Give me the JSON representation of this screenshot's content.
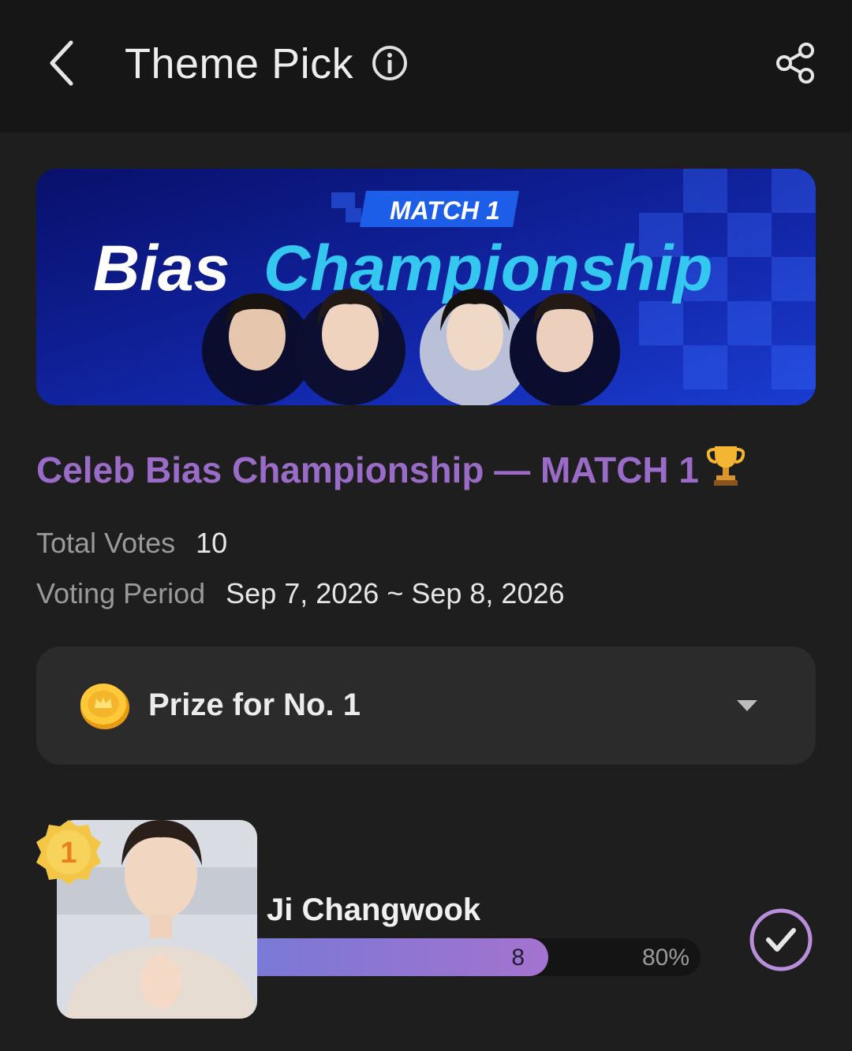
{
  "header": {
    "title": "Theme Pick",
    "icons": {
      "back": "chevron-left-icon",
      "info": "info-icon",
      "share": "share-icon"
    }
  },
  "banner": {
    "match_label": "MATCH 1",
    "title_part1": "Bias",
    "title_part2": "Championship"
  },
  "theme": {
    "title": "Celeb Bias Championship — MATCH 1",
    "total_votes_label": "Total Votes",
    "total_votes": "10",
    "period_label": "Voting Period",
    "period": "Sep 7, 2026 ~ Sep 8, 2026"
  },
  "prize": {
    "label": "Prize for No. 1",
    "icon": "coin-icon"
  },
  "candidates": [
    {
      "rank": "1",
      "name": "Ji Changwook",
      "votes": "8",
      "percent_label": "80%",
      "percent": 80,
      "voted": true
    }
  ],
  "colors": {
    "accent_purple": "#9a6cc8",
    "bar_start": "#7a78d6",
    "bar_end": "#a473cf",
    "banner_blue": "#0d1a7a",
    "banner_cyan": "#34c8f0"
  }
}
